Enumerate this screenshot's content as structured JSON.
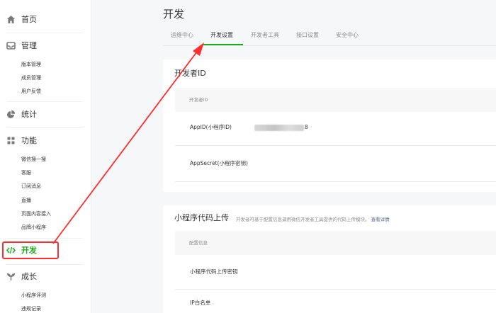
{
  "sidebar": {
    "home": {
      "label": "首页",
      "icon": "home-icon"
    },
    "manage": {
      "label": "管理",
      "icon": "inbox-icon",
      "items": [
        "版本管理",
        "成员管理",
        "用户反馈"
      ]
    },
    "stats": {
      "label": "统计",
      "icon": "pie-chart-icon"
    },
    "features": {
      "label": "功能",
      "icon": "grid-icon",
      "items": [
        "微信搜一搜",
        "客服",
        "订阅消息",
        "直播",
        "页面内容接入",
        "品牌小程序"
      ]
    },
    "develop": {
      "label": "开发",
      "icon": "code-icon"
    },
    "growth": {
      "label": "成长",
      "icon": "sprout-icon",
      "items": [
        "小程序评测",
        "违规记录"
      ]
    }
  },
  "page": {
    "title": "开发"
  },
  "tabs": [
    "运维中心",
    "开发设置",
    "开发者工具",
    "接口设置",
    "安全中心"
  ],
  "active_tab": "开发设置",
  "developer_id": {
    "title": "开发者ID",
    "table_header": "开发者ID",
    "appid_label": "AppID(小程序ID)",
    "appid_value_suffix": "8",
    "appsecret_label": "AppSecret(小程序密钥)"
  },
  "upload": {
    "title": "小程序代码上传",
    "desc": "开发者可基于配置信息调用微信开发者工具提供的代码上传模块。",
    "desc_link": "查看详情",
    "table_header": "配置信息",
    "row1": "小程序代码上传密钥",
    "row2": "IP白名单"
  },
  "colors": {
    "accent": "#1aad19",
    "annotation": "#ff2d2d",
    "link": "#576b95"
  }
}
